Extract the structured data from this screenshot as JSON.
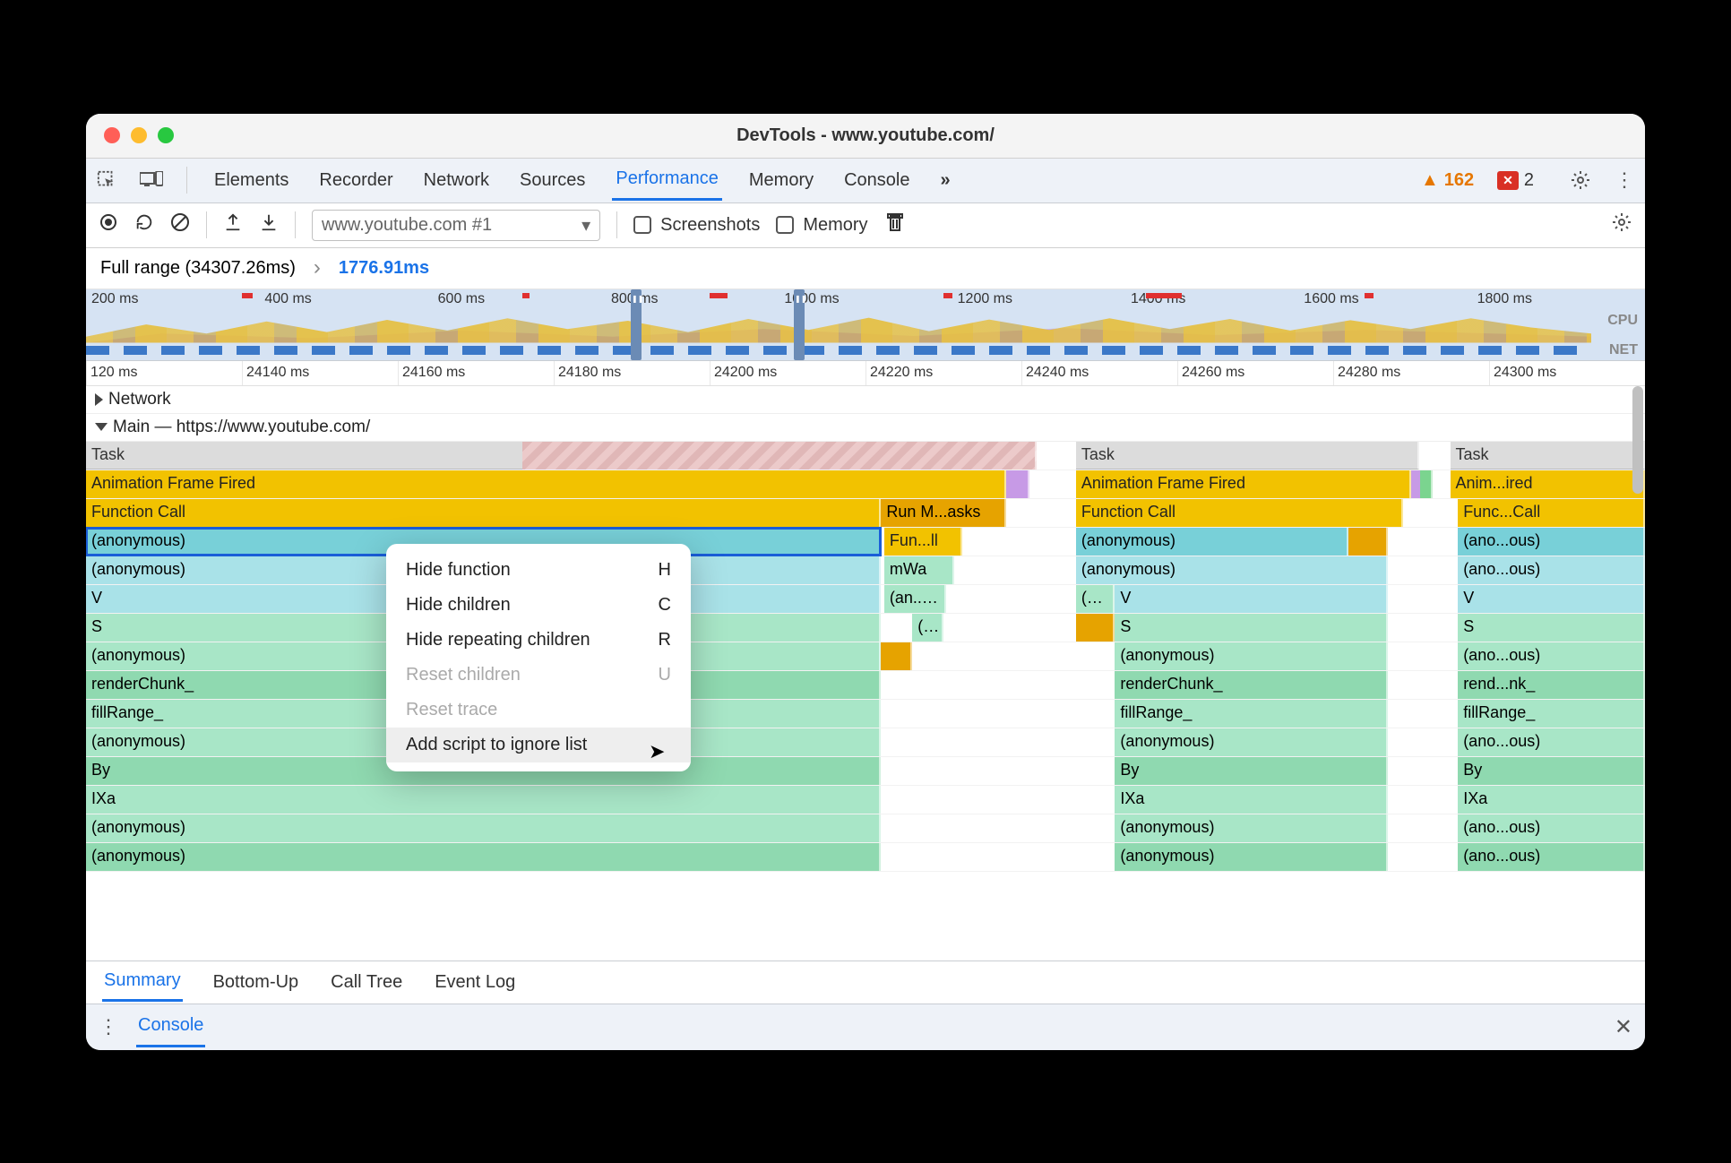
{
  "window": {
    "title": "DevTools - www.youtube.com/"
  },
  "tabs": {
    "items": [
      "Elements",
      "Recorder",
      "Network",
      "Sources",
      "Performance",
      "Memory",
      "Console"
    ],
    "active": "Performance",
    "more": "»",
    "warnings": "162",
    "errors": "2"
  },
  "toolbar": {
    "profile_select": "www.youtube.com #1",
    "screenshots_label": "Screenshots",
    "memory_label": "Memory"
  },
  "crumbs": {
    "full_range": "Full range (34307.26ms)",
    "chevron": "›",
    "selection": "1776.91ms"
  },
  "overview": {
    "ticks": [
      "200 ms",
      "400 ms",
      "600 ms",
      "800 ms",
      "1000 ms",
      "1200 ms",
      "1400 ms",
      "1600 ms",
      "1800 ms"
    ],
    "cpu_label": "CPU",
    "net_label": "NET"
  },
  "ruler": {
    "ticks": [
      "120 ms",
      "24140 ms",
      "24160 ms",
      "24180 ms",
      "24200 ms",
      "24220 ms",
      "24240 ms",
      "24260 ms",
      "24280 ms",
      "24300 ms"
    ]
  },
  "tracks": {
    "network": "Network",
    "main": "Main — https://www.youtube.com/"
  },
  "flame": {
    "col1": {
      "task": "Task",
      "aff": "Animation Frame Fired",
      "fcall": "Function Call",
      "runm": "Run M...asks",
      "anon_sel": "(anonymous)",
      "funll": "Fun...ll",
      "anon2": "(anonymous)",
      "mwa": "mWa",
      "v": "V",
      "ans": "(an...s)",
      "s": "S",
      "paren": "(...",
      "anon3": "(anonymous)",
      "renderChunk": "renderChunk_",
      "fillRange": "fillRange_",
      "anon4": "(anonymous)",
      "by": "By",
      "ixa": "IXa",
      "anon5": "(anonymous)",
      "anon6": "(anonymous)"
    },
    "col2": {
      "task": "Task",
      "aff": "Animation Frame Fired",
      "fcall": "Function Call",
      "anon1": "(anonymous)",
      "anon2": "(anonymous)",
      "dots": "(…",
      "v": "V",
      "s": "S",
      "anon3": "(anonymous)",
      "renderChunk": "renderChunk_",
      "fillRange": "fillRange_",
      "anon4": "(anonymous)",
      "by": "By",
      "ixa": "IXa",
      "anon5": "(anonymous)",
      "anon6": "(anonymous)"
    },
    "col3": {
      "task": "Task",
      "aff": "Anim...ired",
      "fcall": "Func...Call",
      "anon1": "(ano...ous)",
      "anon2": "(ano...ous)",
      "v": "V",
      "s": "S",
      "anon3": "(ano...ous)",
      "renderChunk": "rend...nk_",
      "fillRange": "fillRange_",
      "anon4": "(ano...ous)",
      "by": "By",
      "ixa": "IXa",
      "anon5": "(ano...ous)",
      "anon6": "(ano...ous)"
    }
  },
  "context_menu": {
    "items": [
      {
        "label": "Hide function",
        "key": "H",
        "disabled": false
      },
      {
        "label": "Hide children",
        "key": "C",
        "disabled": false
      },
      {
        "label": "Hide repeating children",
        "key": "R",
        "disabled": false
      },
      {
        "label": "Reset children",
        "key": "U",
        "disabled": true
      },
      {
        "label": "Reset trace",
        "key": "",
        "disabled": true
      },
      {
        "label": "Add script to ignore list",
        "key": "",
        "disabled": false,
        "hovered": true
      }
    ]
  },
  "bottom_tabs": {
    "items": [
      "Summary",
      "Bottom-Up",
      "Call Tree",
      "Event Log"
    ],
    "active": "Summary"
  },
  "drawer": {
    "console": "Console"
  }
}
